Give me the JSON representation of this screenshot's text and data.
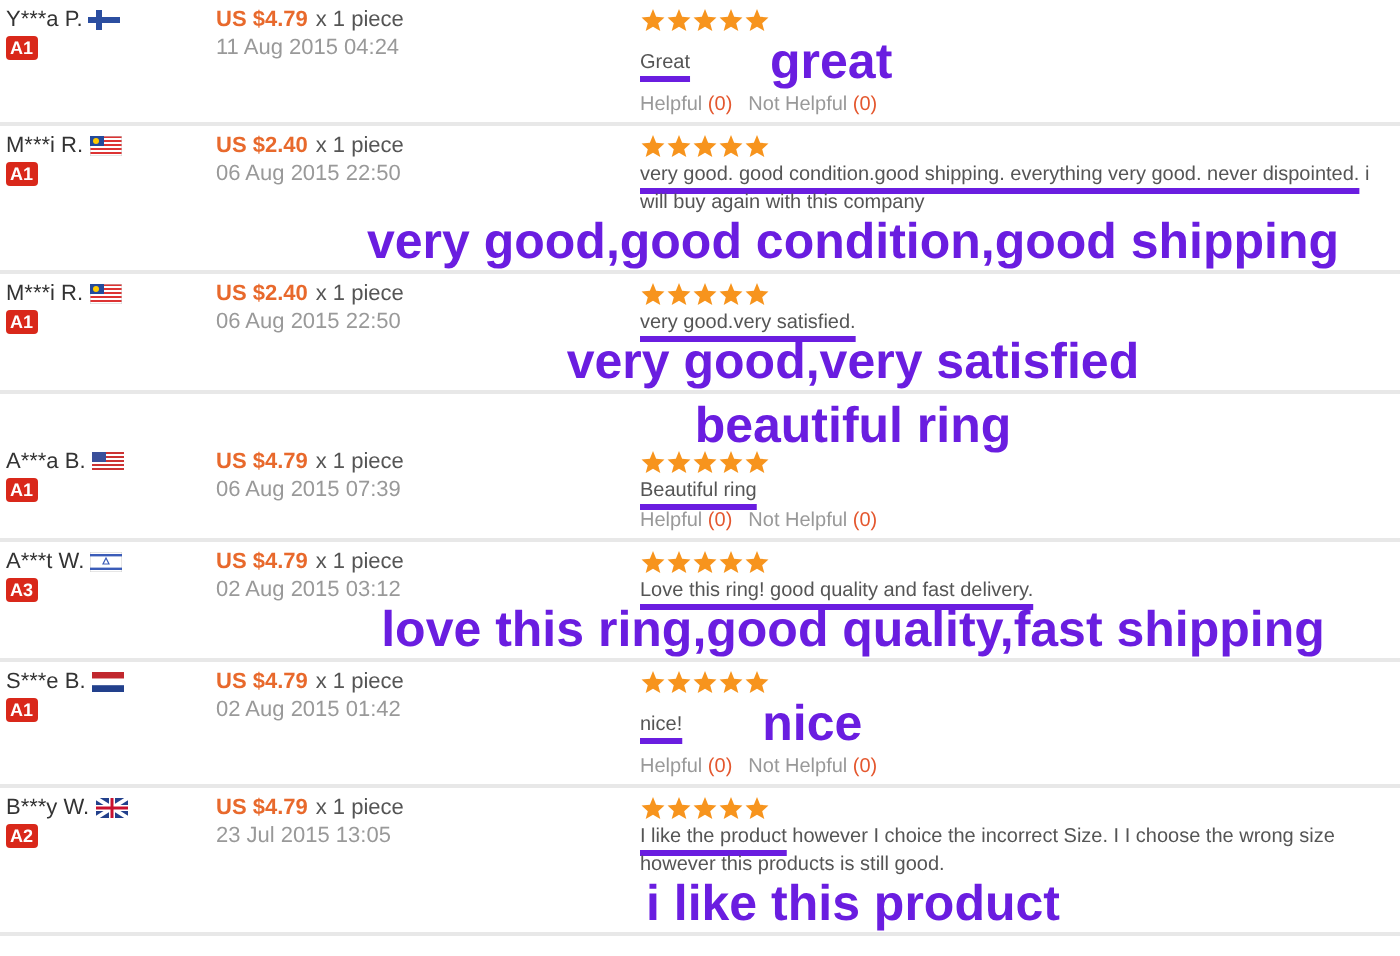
{
  "reviews": [
    {
      "name": "Y***a P.",
      "flag": {
        "kind": "fi"
      },
      "badge": "A1",
      "price": "US $4.79",
      "quantity": "x 1 piece",
      "date": "11 Aug 2015 04:24",
      "stars": 5,
      "comment_marked": "Great",
      "annotation": {
        "text": "great",
        "kind": "inline"
      },
      "helpful": {
        "label": "Helpful",
        "count": "(0)"
      },
      "not_helpful": {
        "label": "Not Helpful",
        "count": "(0)"
      }
    },
    {
      "name": "M***i R.",
      "flag": {
        "kind": "my"
      },
      "badge": "A1",
      "price": "US $2.40",
      "quantity": "x 1 piece",
      "date": "06 Aug 2015 22:50",
      "stars": 5,
      "comment_marked": "very good. good condition.good shipping. everything very good. never dispointed.",
      "comment_rest": " i will buy again with this company",
      "annotation": {
        "text": "very good,good condition,good shipping",
        "kind": "below"
      }
    },
    {
      "name": "M***i R.",
      "flag": {
        "kind": "my"
      },
      "badge": "A1",
      "price": "US $2.40",
      "quantity": "x 1 piece",
      "date": "06 Aug 2015 22:50",
      "stars": 5,
      "comment_marked": "very good.very satisfied.",
      "annotation": {
        "text": "very good,very satisfied",
        "kind": "below"
      }
    },
    {
      "name": "A***a B.",
      "flag": {
        "kind": "us"
      },
      "badge": "A1",
      "price": "US $4.79",
      "quantity": "x 1 piece",
      "date": "06 Aug 2015 07:39",
      "stars": 5,
      "comment_marked": "Beautiful ring",
      "annotation": {
        "text": "beautiful ring",
        "kind": "above"
      },
      "helpful": {
        "label": "Helpful",
        "count": "(0)"
      },
      "not_helpful": {
        "label": "Not Helpful",
        "count": "(0)"
      }
    },
    {
      "name": "A***t W.",
      "flag": {
        "kind": "il"
      },
      "badge": "A3",
      "price": "US $4.79",
      "quantity": "x 1 piece",
      "date": "02 Aug 2015 03:12",
      "stars": 5,
      "comment_marked": "Love this ring! good quality and fast delivery.",
      "annotation": {
        "text": "love this ring,good quality,fast shipping",
        "kind": "below"
      }
    },
    {
      "name": "S***e B.",
      "flag": {
        "kind": "nl"
      },
      "badge": "A1",
      "price": "US $4.79",
      "quantity": "x 1 piece",
      "date": "02 Aug 2015 01:42",
      "stars": 5,
      "comment_marked": "nice!",
      "annotation": {
        "text": "nice",
        "kind": "inline"
      },
      "helpful": {
        "label": "Helpful",
        "count": "(0)"
      },
      "not_helpful": {
        "label": "Not Helpful",
        "count": "(0)"
      }
    },
    {
      "name": "B***y W.",
      "flag": {
        "kind": "gb"
      },
      "badge": "A2",
      "price": "US $4.79",
      "quantity": "x 1 piece",
      "date": "23 Jul 2015 13:05",
      "stars": 5,
      "comment_marked": "I like the product",
      "comment_rest": " however I choice the incorrect Size. I I choose the wrong size however this products is still good.",
      "annotation": {
        "text": "i like this product",
        "kind": "below"
      }
    }
  ]
}
